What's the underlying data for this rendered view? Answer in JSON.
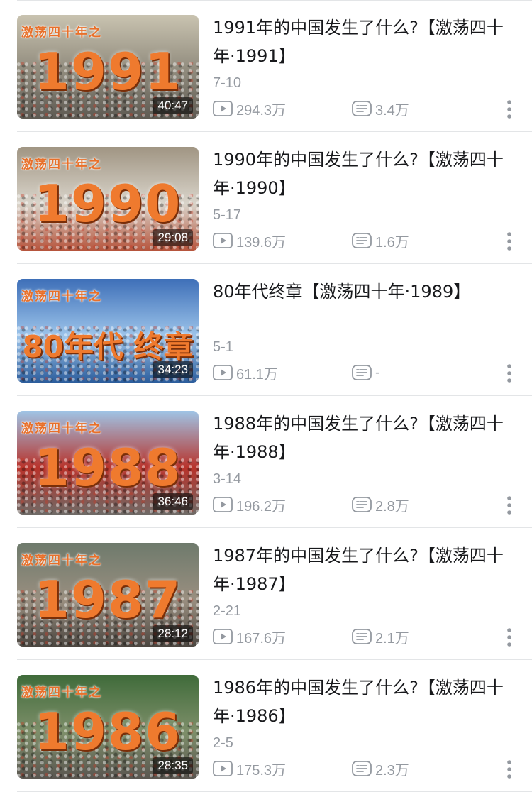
{
  "videos": [
    {
      "title": "1991年的中国发生了什么?【激荡四十年·1991】",
      "date": "7-10",
      "views": "294.3万",
      "danmaku": "3.4万",
      "duration": "40:47",
      "thumb_series": "激荡四十年之",
      "thumb_big": "1991",
      "thumb_colors": {
        "top": "#c9c3b0",
        "mid": "#8f8a7c",
        "bottom": "#5e5a52"
      }
    },
    {
      "title": "1990年的中国发生了什么?【激荡四十年·1990】",
      "date": "5-17",
      "views": "139.6万",
      "danmaku": "1.6万",
      "duration": "29:08",
      "thumb_series": "激荡四十年之",
      "thumb_big": "1990",
      "thumb_colors": {
        "top": "#a09583",
        "mid": "#d9d4ca",
        "bottom": "#b6543c"
      }
    },
    {
      "title": "80年代终章【激荡四十年·1989】",
      "date": "5-1",
      "views": "61.1万",
      "danmaku": "-",
      "duration": "34:23",
      "thumb_series": "激荡四十年之",
      "thumb_big": "80年代 终章",
      "thumb_colors": {
        "top": "#3e6fb8",
        "mid": "#9cc4ea",
        "bottom": "#2c5d9c"
      }
    },
    {
      "title": "1988年的中国发生了什么?【激荡四十年·1988】",
      "date": "3-14",
      "views": "196.2万",
      "danmaku": "2.8万",
      "duration": "36:46",
      "thumb_series": "激荡四十年之",
      "thumb_big": "1988",
      "thumb_colors": {
        "top": "#9fc4e6",
        "mid": "#b8322a",
        "bottom": "#6f6a66"
      }
    },
    {
      "title": "1987年的中国发生了什么?【激荡四十年·1987】",
      "date": "2-21",
      "views": "167.6万",
      "danmaku": "2.1万",
      "duration": "28:12",
      "thumb_series": "激荡四十年之",
      "thumb_big": "1987",
      "thumb_colors": {
        "top": "#6e7a6c",
        "mid": "#9a8f80",
        "bottom": "#4b4640"
      }
    },
    {
      "title": "1986年的中国发生了什么?【激荡四十年·1986】",
      "date": "2-5",
      "views": "175.3万",
      "danmaku": "2.3万",
      "duration": "28:35",
      "thumb_series": "激荡四十年之",
      "thumb_big": "1986",
      "thumb_colors": {
        "top": "#3f6b3a",
        "mid": "#7e8f6a",
        "bottom": "#5a5650"
      }
    }
  ],
  "icons": {
    "views": "play-count-icon",
    "danmaku": "danmaku-icon",
    "more": "more-vertical-icon"
  },
  "colors": {
    "title_text": "#18191c",
    "meta_text": "#9499a0",
    "thumb_accent": "#ef7a2e"
  }
}
